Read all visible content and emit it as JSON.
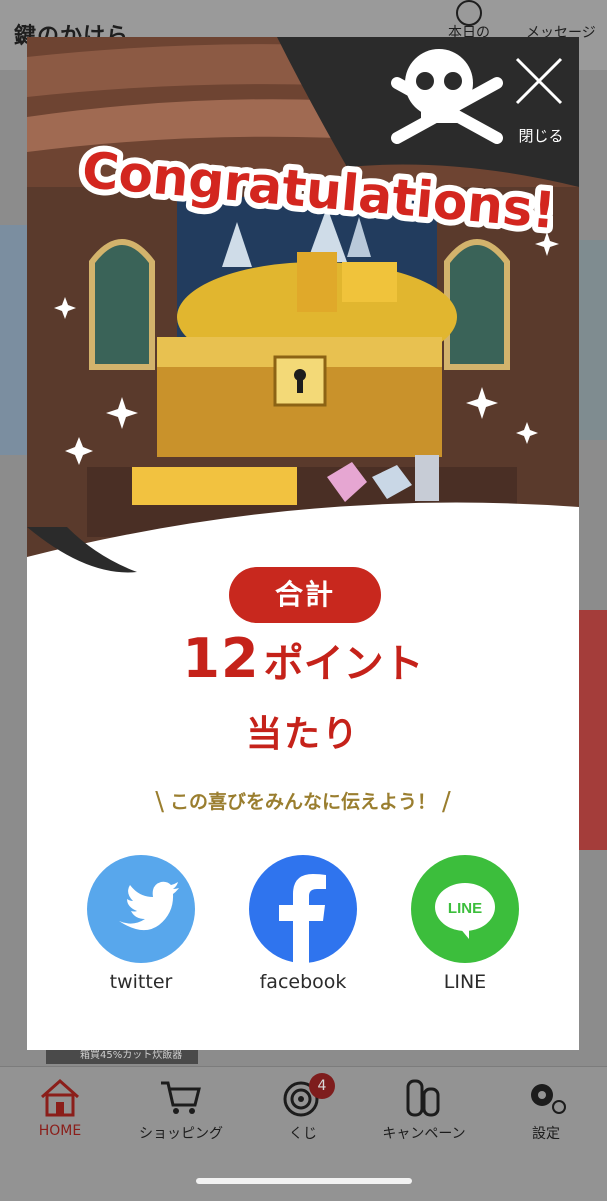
{
  "background": {
    "logo": "鍵のかけら",
    "header_buttons": [
      "本日の",
      "メッセージ"
    ],
    "banner_text": "箱買45%カット炊飯器"
  },
  "tabbar": {
    "items": [
      {
        "label": "HOME",
        "icon": "home-icon",
        "active": true
      },
      {
        "label": "ショッピング",
        "icon": "cart-icon"
      },
      {
        "label": "くじ",
        "icon": "target-icon",
        "badge": "4"
      },
      {
        "label": "キャンペーン",
        "icon": "coins-icon"
      },
      {
        "label": "設定",
        "icon": "gear-icon"
      }
    ]
  },
  "modal": {
    "close_label": "閉じる",
    "heading": "Congratulations!",
    "total_label": "合計",
    "points": "12",
    "points_unit": "ポイント",
    "win_text": "当たり",
    "share_prompt": "この喜びをみんなに伝えよう！",
    "share": [
      {
        "label": "twitter",
        "icon": "twitter-bird-icon",
        "color": "#58a7ec"
      },
      {
        "label": "facebook",
        "icon": "facebook-icon",
        "color": "#2f74ee"
      },
      {
        "label": "LINE",
        "icon": "line-icon",
        "color": "#3cbe3c"
      }
    ],
    "colors": {
      "accent_red": "#c8281e",
      "gold_text": "#9a7e2f"
    }
  }
}
